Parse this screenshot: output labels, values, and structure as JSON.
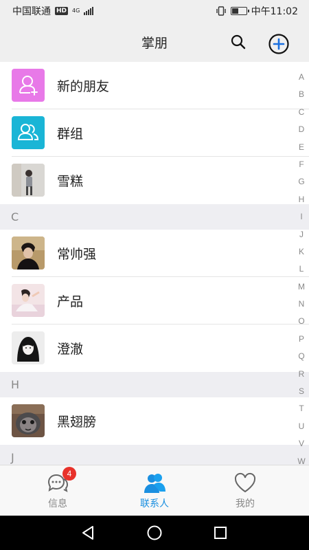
{
  "status_bar": {
    "carrier": "中国联通",
    "hd_badge": "HD",
    "network_type": "4G",
    "time": "中午11:02",
    "battery_level": 0.5
  },
  "header": {
    "title": "掌朋",
    "search_icon": "search-icon",
    "add_icon": "plus-circle-icon"
  },
  "contacts": {
    "top_items": [
      {
        "label": "新的朋友",
        "icon": "person-add-icon",
        "color": "#e879e8"
      },
      {
        "label": "群组",
        "icon": "group-icon",
        "color": "#1ab5d6"
      },
      {
        "label": "雪糕",
        "avatar": "photo-avatar"
      }
    ],
    "sections": [
      {
        "letter": "C",
        "items": [
          {
            "name": "常帅强"
          },
          {
            "name": "产品"
          },
          {
            "name": "澄澈"
          }
        ]
      },
      {
        "letter": "H",
        "items": [
          {
            "name": "黑翅膀"
          }
        ]
      },
      {
        "letter": "J",
        "items": []
      }
    ]
  },
  "index_letters": [
    "A",
    "B",
    "C",
    "D",
    "E",
    "F",
    "G",
    "H",
    "I",
    "J",
    "K",
    "L",
    "M",
    "N",
    "O",
    "P",
    "Q",
    "R",
    "S",
    "T",
    "U",
    "V",
    "W"
  ],
  "tab_bar": {
    "tabs": [
      {
        "label": "信息",
        "icon": "chat-bubbles-icon",
        "badge": "4",
        "active": false
      },
      {
        "label": "联系人",
        "icon": "contacts-icon",
        "active": true
      },
      {
        "label": "我的",
        "icon": "heart-icon",
        "active": false
      }
    ]
  },
  "colors": {
    "accent": "#1a8fe0",
    "badge": "#e8322b",
    "new_friend_tile": "#e879e8",
    "group_tile": "#1ab5d6"
  }
}
